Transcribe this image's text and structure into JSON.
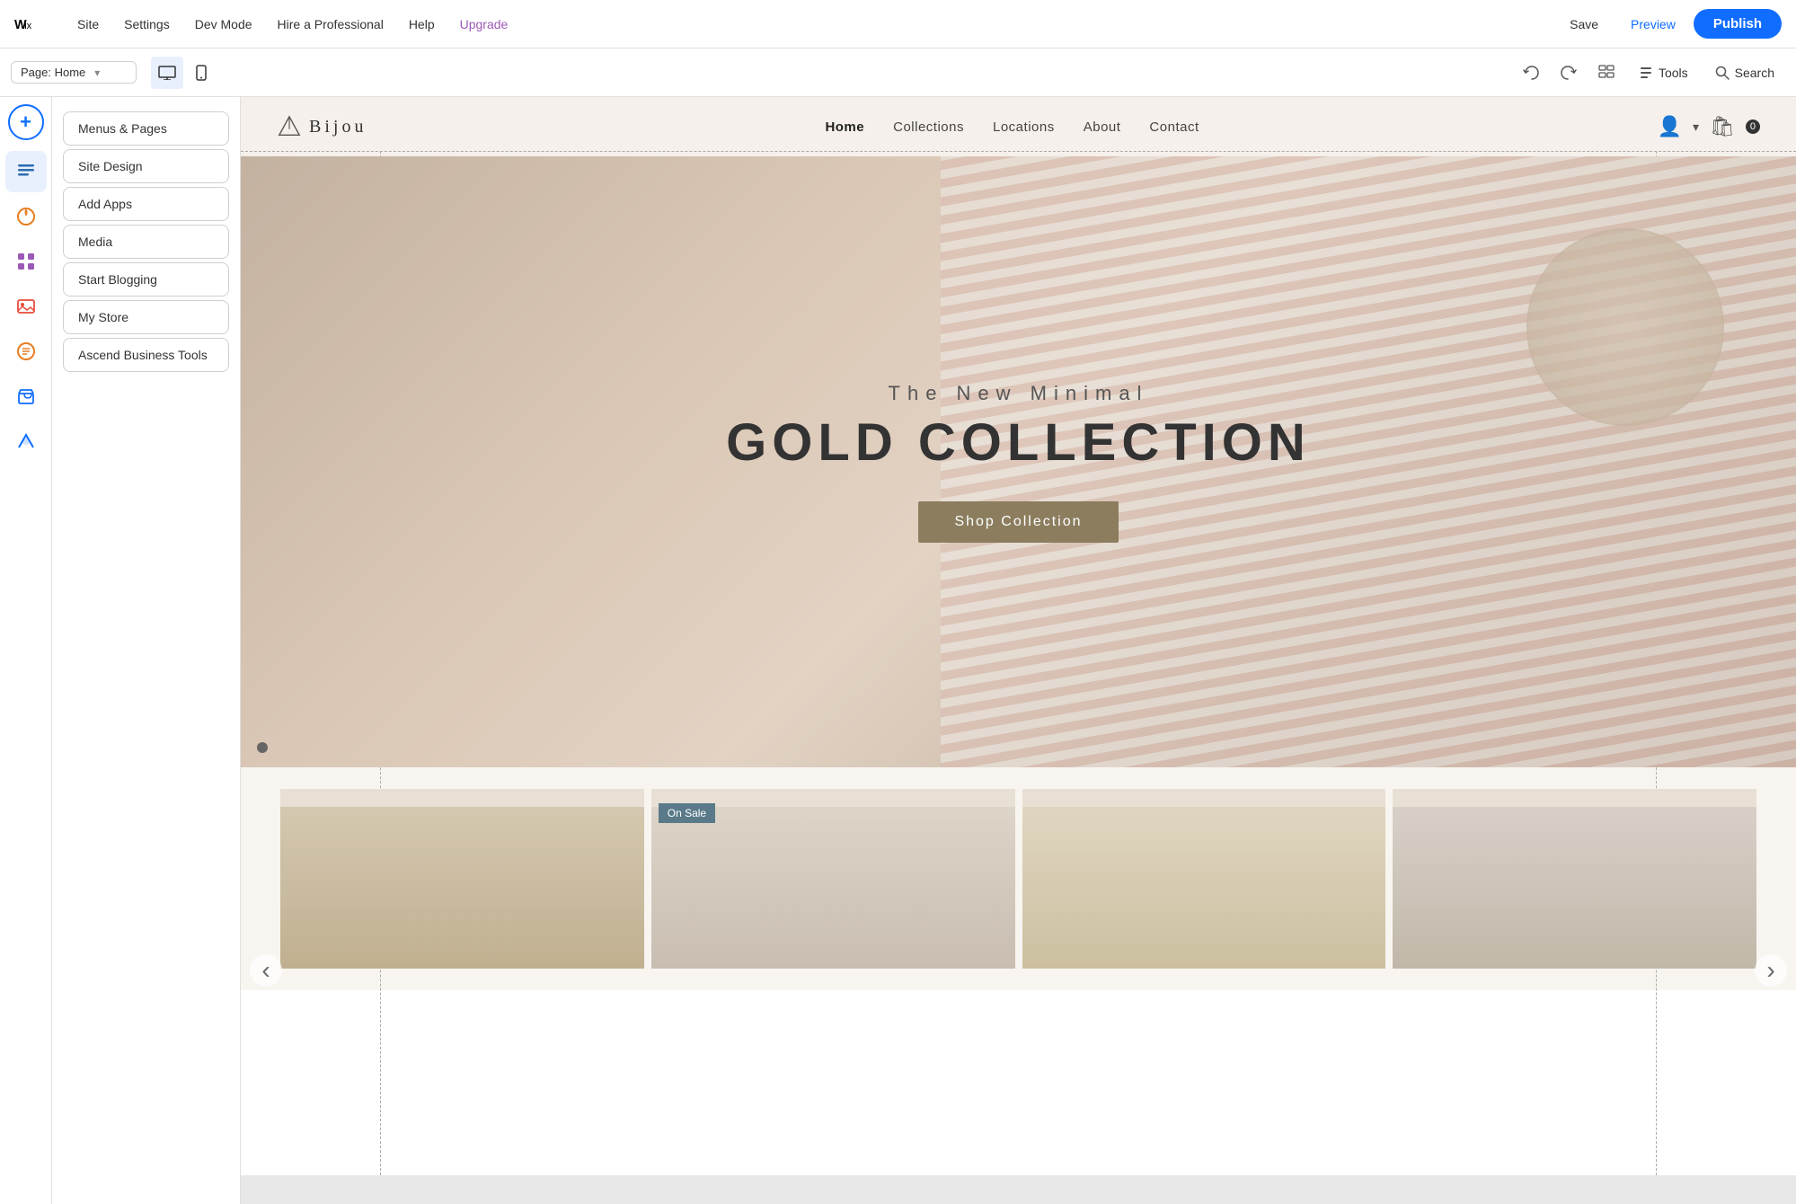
{
  "topbar": {
    "logo_text": "wix",
    "nav_items": [
      "Site",
      "Settings",
      "Dev Mode",
      "Hire a Professional",
      "Help",
      "Upgrade"
    ],
    "upgrade_label": "Upgrade",
    "save_label": "Save",
    "preview_label": "Preview",
    "publish_label": "Publish"
  },
  "secondbar": {
    "page_label": "Page: Home",
    "tools_label": "Tools",
    "search_label": "Search"
  },
  "sidebar": {
    "add_label": "+",
    "icons": [
      {
        "name": "pages-icon",
        "symbol": "☰"
      },
      {
        "name": "design-icon",
        "symbol": "🎨"
      },
      {
        "name": "apps-icon",
        "symbol": "⊞"
      },
      {
        "name": "media-icon",
        "symbol": "🖼"
      },
      {
        "name": "blog-icon",
        "symbol": "✏"
      },
      {
        "name": "store-icon",
        "symbol": "🛍"
      },
      {
        "name": "ascend-icon",
        "symbol": "↑"
      }
    ]
  },
  "quick_panel": {
    "buttons": [
      "Menus & Pages",
      "Site Design",
      "Add Apps",
      "Media",
      "Start Blogging",
      "My Store",
      "Ascend Business Tools"
    ]
  },
  "site": {
    "logo_text": "Bijou",
    "nav": [
      "Home",
      "Collections",
      "Locations",
      "About",
      "Contact"
    ],
    "hero": {
      "subtitle": "The New Minimal",
      "title": "GOLD COLLECTION",
      "cta": "Shop Collection"
    },
    "product_badge": "On Sale",
    "arrow_left": "‹",
    "arrow_right": "›"
  }
}
